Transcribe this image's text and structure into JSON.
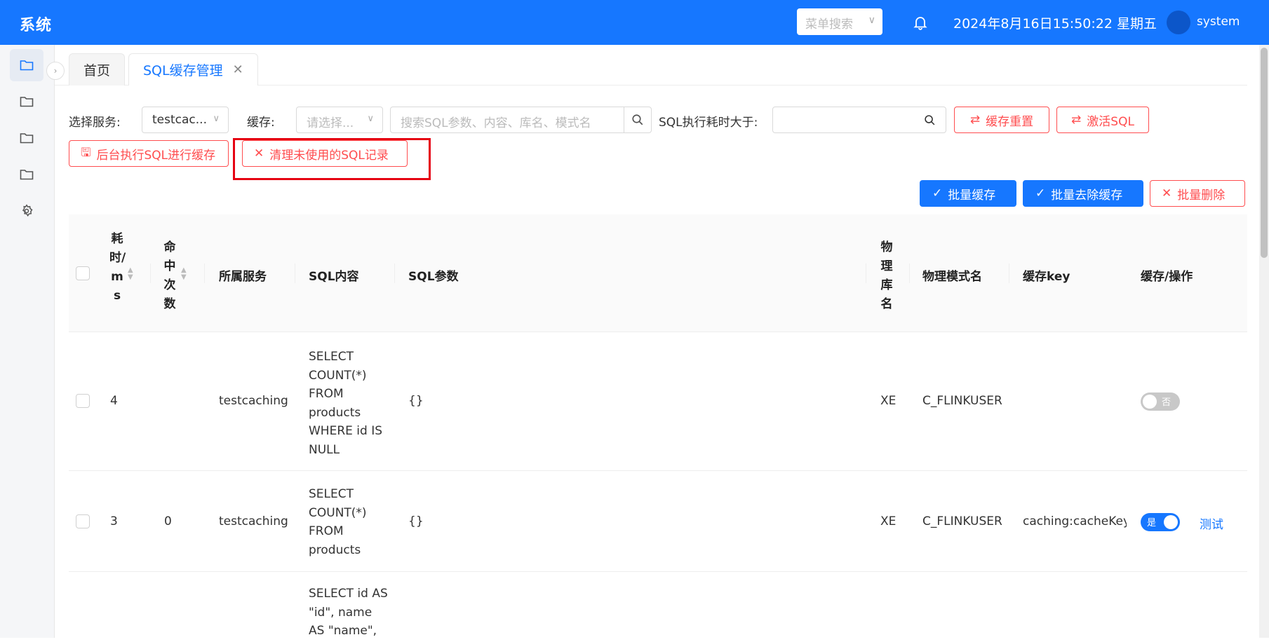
{
  "header": {
    "title": "系统",
    "menu_search_placeholder": "菜单搜索",
    "datetime": "2024年8月16日15:50:22 星期五",
    "username": "system"
  },
  "tabs": [
    {
      "label": "首页"
    },
    {
      "label": "SQL缓存管理"
    }
  ],
  "filters": {
    "service_label": "选择服务:",
    "service_value": "testcac...",
    "cache_label": "缓存:",
    "cache_placeholder": "请选择...",
    "search_placeholder": "搜索SQL参数、内容、库名、模式名",
    "duration_label": "SQL执行耗时大于:",
    "duration_placeholder": ""
  },
  "actions": {
    "reset_cache": "缓存重置",
    "activate_sql": "激活SQL",
    "background_exec": "后台执行SQL进行缓存",
    "clean_unused": "清理未使用的SQL记录",
    "batch_cache": "批量缓存",
    "batch_uncache": "批量去除缓存",
    "batch_delete": "批量删除"
  },
  "table": {
    "headers": {
      "duration": "耗时/ms",
      "hits": "命中次数",
      "service": "所属服务",
      "sql_content": "SQL内容",
      "sql_params": "SQL参数",
      "db_name": "物理库名",
      "schema_name": "物理模式名",
      "cache_key": "缓存key",
      "cache_ops": "缓存/操作"
    },
    "rows": [
      {
        "duration": "4",
        "hits": "",
        "service": "testcaching",
        "sql_lines": [
          "SELECT",
          "COUNT(*)",
          "FROM",
          "products",
          "WHERE id IS",
          "NULL"
        ],
        "params": "{}",
        "db": "XE",
        "schema": "C_FLINKUSER",
        "cache_key": "",
        "toggle_text": "否",
        "toggle_on": false,
        "action": ""
      },
      {
        "duration": "3",
        "hits": "0",
        "service": "testcaching",
        "sql_lines": [
          "SELECT",
          "COUNT(*)",
          "FROM",
          "products"
        ],
        "params": "{}",
        "db": "XE",
        "schema": "C_FLINKUSER",
        "cache_key": "caching:cacheKey|X",
        "toggle_text": "是",
        "toggle_on": true,
        "action": "测试"
      },
      {
        "duration": "",
        "hits": "",
        "service": "",
        "sql_lines": [
          "SELECT id AS",
          "\"id\", name",
          "AS \"name\","
        ],
        "params": "",
        "db": "",
        "schema": "",
        "cache_key": "",
        "toggle_text": "",
        "toggle_on": false,
        "action": ""
      }
    ]
  },
  "colors": {
    "primary": "#1677ff",
    "danger": "#ff4d4f",
    "highlight": "#e60012"
  }
}
